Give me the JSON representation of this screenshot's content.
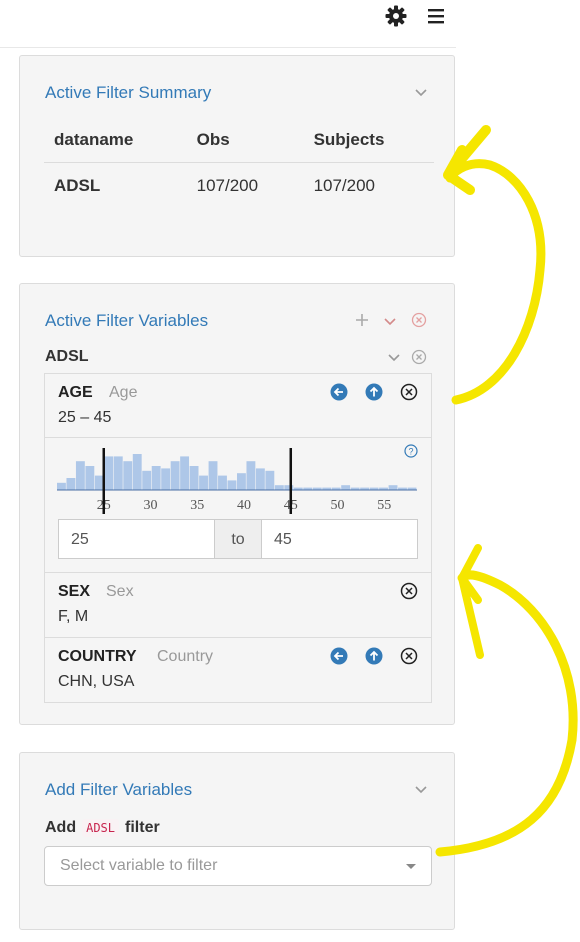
{
  "header": {
    "settings_icon": "gear-icon",
    "menu_icon": "hamburger-icon"
  },
  "summary": {
    "title": "Active Filter Summary",
    "columns": [
      "dataname",
      "Obs",
      "Subjects"
    ],
    "rows": [
      {
        "dataname": "ADSL",
        "obs": "107/200",
        "subjects": "107/200"
      }
    ]
  },
  "active": {
    "title": "Active Filter Variables",
    "dataset": "ADSL",
    "age": {
      "name": "AGE",
      "label": "Age",
      "value": "25 – 45",
      "from": "25",
      "to_label": "to",
      "to": "45",
      "ticks": [
        "25",
        "30",
        "35",
        "40",
        "45",
        "50",
        "55"
      ],
      "histogram": [
        3,
        5,
        12,
        10,
        6,
        14,
        14,
        12,
        15,
        8,
        10,
        9,
        12,
        14,
        10,
        6,
        12,
        6,
        4,
        7,
        12,
        9,
        8,
        2,
        2,
        1,
        1,
        1,
        1,
        1,
        2,
        1,
        1,
        1,
        1,
        2,
        1,
        1
      ],
      "range": [
        25,
        45
      ]
    },
    "sex": {
      "name": "SEX",
      "label": "Sex",
      "value": "F, M"
    },
    "country": {
      "name": "COUNTRY",
      "label": "Country",
      "value": "CHN, USA"
    }
  },
  "add": {
    "title": "Add Filter Variables",
    "label_prefix": "Add",
    "dataset_code": "ADSL",
    "label_suffix": "filter",
    "placeholder": "Select variable to filter"
  },
  "colors": {
    "accent": "#337ab7",
    "icon_blue": "#337ab7",
    "remove_red": "#d9534f",
    "annotation": "#f5e600",
    "bar": "#aec7e8"
  }
}
